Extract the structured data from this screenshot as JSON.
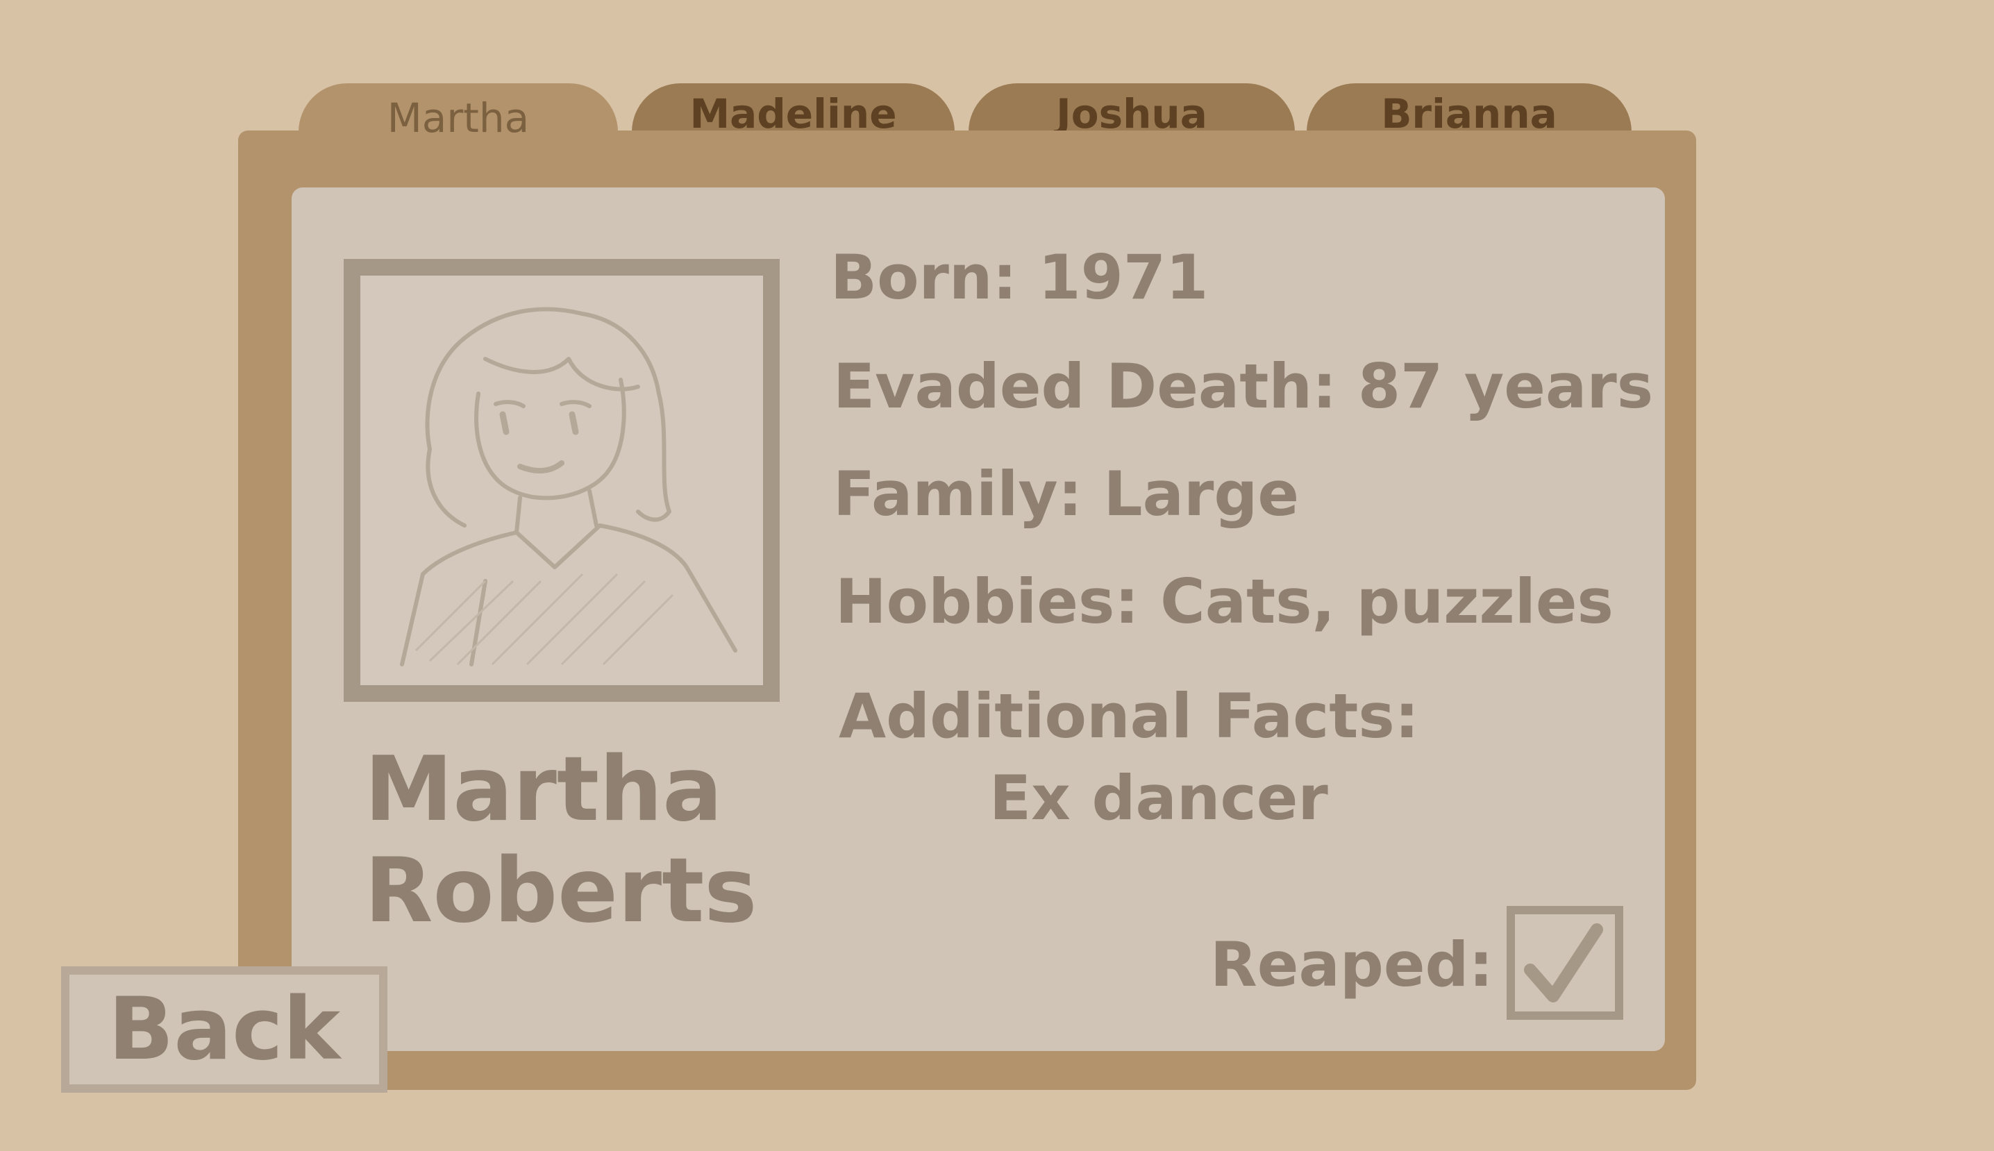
{
  "tabs": [
    {
      "label": "Martha",
      "active": true
    },
    {
      "label": "Madeline",
      "active": false
    },
    {
      "label": "Joshua",
      "active": false
    },
    {
      "label": "Brianna",
      "active": false
    }
  ],
  "profile": {
    "first_name": "Martha",
    "last_name": "Roberts",
    "born": "Born: 1971",
    "evaded_death": "Evaded Death: 87 years",
    "family": "Family: Large",
    "hobbies": "Hobbies: Cats, puzzles",
    "additional_facts_label": "Additional Facts:",
    "additional_facts_value": "Ex dancer",
    "reaped_label": "Reaped:",
    "reaped": true
  },
  "back_label": "Back",
  "colors": {
    "background": "#d7c2a5",
    "folder": "#b3936b",
    "tab_inactive": "#9b7b53",
    "card": "#d0c4b7",
    "text": "#8f8072",
    "tab_text": "#5e4122"
  }
}
